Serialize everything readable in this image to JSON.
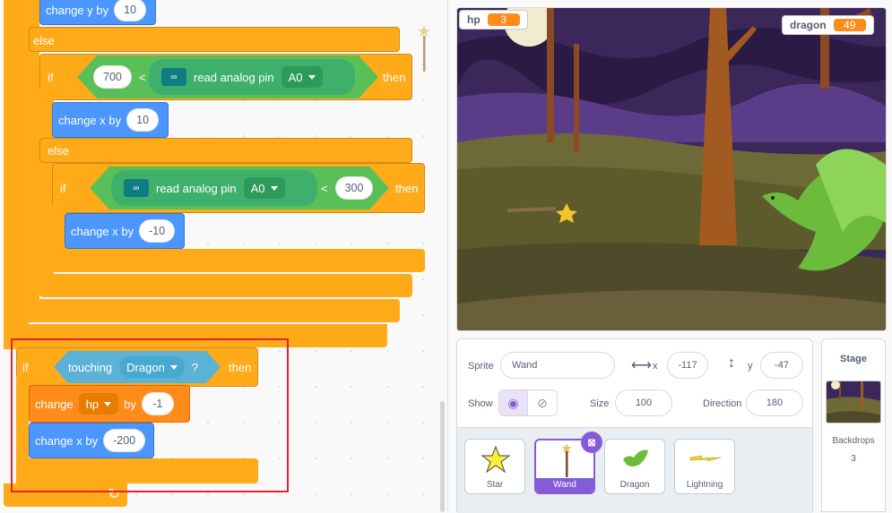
{
  "code": {
    "change_y_label": "change y by",
    "change_y_value": "10",
    "else1": "else",
    "if1": "if",
    "cmp1_left": "700",
    "cmp1_op": "<",
    "read_analog_label": "read analog pin",
    "pin": "A0",
    "then1": "then",
    "change_x_label": "change x by",
    "change_x_pos": "10",
    "else2": "else",
    "if2": "if",
    "cmp2_op": "<",
    "cmp2_right": "300",
    "then2": "then",
    "change_x_neg": "-10",
    "if3": "if",
    "touching_label": "touching",
    "touching_target": "Dragon",
    "question": "?",
    "then3": "then",
    "change_label": "change",
    "var_name": "hp",
    "by_label": "by",
    "change_var_value": "-1",
    "change_x_big": "-200"
  },
  "stage": {
    "monitors": [
      {
        "label": "hp",
        "value": "3"
      },
      {
        "label": "dragon",
        "value": "49"
      }
    ]
  },
  "sprite_info": {
    "sprite_label": "Sprite",
    "sprite_name": "Wand",
    "x_label": "x",
    "x_value": "-117",
    "y_label": "y",
    "y_value": "-47",
    "show_label": "Show",
    "size_label": "Size",
    "size_value": "100",
    "direction_label": "Direction",
    "direction_value": "180"
  },
  "sprites": [
    "Star",
    "Wand",
    "Dragon",
    "Lightning"
  ],
  "stage_panel": {
    "title": "Stage",
    "backdrops_label": "Backdrops",
    "backdrops_count": "3"
  },
  "colors": {
    "control": "#ffab19",
    "motion": "#4c97ff",
    "variables": "#ff8c1a",
    "operators": "#59c059",
    "sensing": "#5cb1d6",
    "selection": "#855cd6",
    "highlight": "#e3242b"
  }
}
